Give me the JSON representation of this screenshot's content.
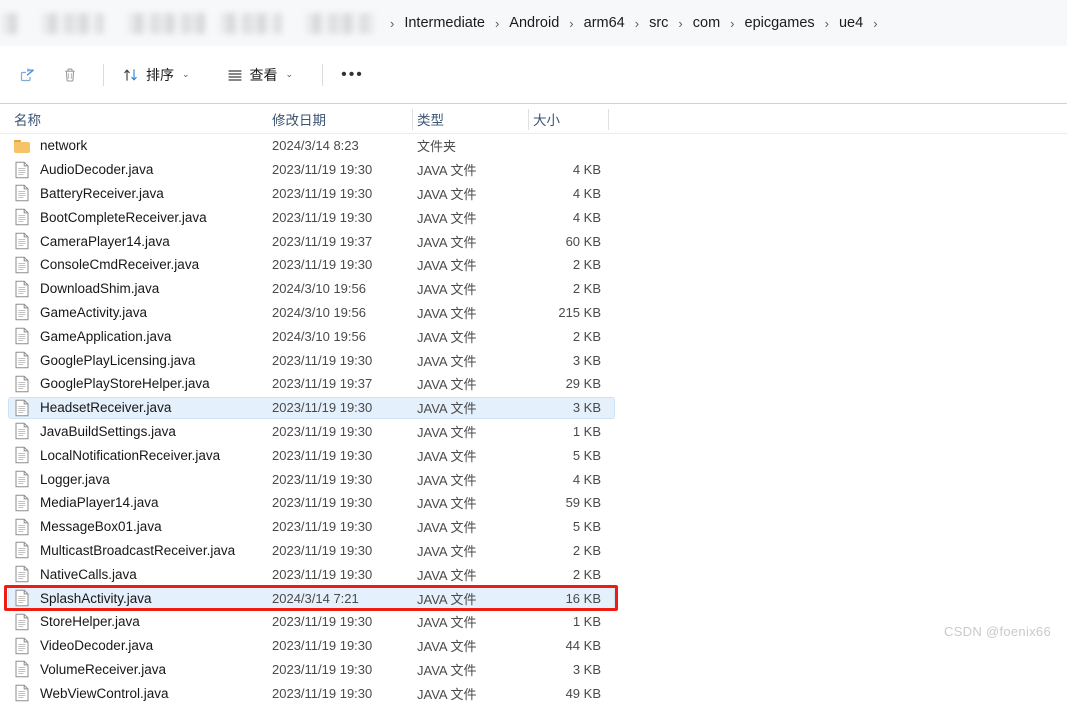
{
  "addressbar": {
    "redacted_segment_count": 5,
    "separator": "›",
    "crumbs": [
      "Intermediate",
      "Android",
      "arm64",
      "src",
      "com",
      "epicgames",
      "ue4"
    ]
  },
  "toolbar": {
    "share_label": "",
    "delete_label": "",
    "sort_label": "排序",
    "view_label": "查看",
    "more_label": "•••",
    "caret": "⌄",
    "icons": {
      "share": "share-icon",
      "delete": "trash-icon",
      "sort": "sort-arrows-icon",
      "view": "list-view-icon",
      "more": "ellipsis-icon"
    }
  },
  "columns": {
    "name": "名称",
    "date": "修改日期",
    "type": "类型",
    "size": "大小",
    "sort_indicator": "∧"
  },
  "colors": {
    "selection": "#e4f0fb",
    "selection_border": "#cfe3f6",
    "annotation_red": "#ef1c12",
    "folder_icon": "#f6c368",
    "header_text": "#3b5573",
    "addressbar_bg": "#f6f8fa"
  },
  "files": [
    {
      "name": "network",
      "date": "2024/3/14 8:23",
      "type": "文件夹",
      "size": "",
      "icon": "folder-icon",
      "selected": false,
      "annotated": false
    },
    {
      "name": "AudioDecoder.java",
      "date": "2023/11/19 19:30",
      "type": "JAVA 文件",
      "size": "4 KB",
      "icon": "file-icon",
      "selected": false,
      "annotated": false
    },
    {
      "name": "BatteryReceiver.java",
      "date": "2023/11/19 19:30",
      "type": "JAVA 文件",
      "size": "4 KB",
      "icon": "file-icon",
      "selected": false,
      "annotated": false
    },
    {
      "name": "BootCompleteReceiver.java",
      "date": "2023/11/19 19:30",
      "type": "JAVA 文件",
      "size": "4 KB",
      "icon": "file-icon",
      "selected": false,
      "annotated": false
    },
    {
      "name": "CameraPlayer14.java",
      "date": "2023/11/19 19:37",
      "type": "JAVA 文件",
      "size": "60 KB",
      "icon": "file-icon",
      "selected": false,
      "annotated": false
    },
    {
      "name": "ConsoleCmdReceiver.java",
      "date": "2023/11/19 19:30",
      "type": "JAVA 文件",
      "size": "2 KB",
      "icon": "file-icon",
      "selected": false,
      "annotated": false
    },
    {
      "name": "DownloadShim.java",
      "date": "2024/3/10 19:56",
      "type": "JAVA 文件",
      "size": "2 KB",
      "icon": "file-icon",
      "selected": false,
      "annotated": false
    },
    {
      "name": "GameActivity.java",
      "date": "2024/3/10 19:56",
      "type": "JAVA 文件",
      "size": "215 KB",
      "icon": "file-icon",
      "selected": false,
      "annotated": false
    },
    {
      "name": "GameApplication.java",
      "date": "2024/3/10 19:56",
      "type": "JAVA 文件",
      "size": "2 KB",
      "icon": "file-icon",
      "selected": false,
      "annotated": false
    },
    {
      "name": "GooglePlayLicensing.java",
      "date": "2023/11/19 19:30",
      "type": "JAVA 文件",
      "size": "3 KB",
      "icon": "file-icon",
      "selected": false,
      "annotated": false
    },
    {
      "name": "GooglePlayStoreHelper.java",
      "date": "2023/11/19 19:37",
      "type": "JAVA 文件",
      "size": "29 KB",
      "icon": "file-icon",
      "selected": false,
      "annotated": false
    },
    {
      "name": "HeadsetReceiver.java",
      "date": "2023/11/19 19:30",
      "type": "JAVA 文件",
      "size": "3 KB",
      "icon": "file-icon",
      "selected": true,
      "annotated": false
    },
    {
      "name": "JavaBuildSettings.java",
      "date": "2023/11/19 19:30",
      "type": "JAVA 文件",
      "size": "1 KB",
      "icon": "file-icon",
      "selected": false,
      "annotated": false
    },
    {
      "name": "LocalNotificationReceiver.java",
      "date": "2023/11/19 19:30",
      "type": "JAVA 文件",
      "size": "5 KB",
      "icon": "file-icon",
      "selected": false,
      "annotated": false
    },
    {
      "name": "Logger.java",
      "date": "2023/11/19 19:30",
      "type": "JAVA 文件",
      "size": "4 KB",
      "icon": "file-icon",
      "selected": false,
      "annotated": false
    },
    {
      "name": "MediaPlayer14.java",
      "date": "2023/11/19 19:30",
      "type": "JAVA 文件",
      "size": "59 KB",
      "icon": "file-icon",
      "selected": false,
      "annotated": false
    },
    {
      "name": "MessageBox01.java",
      "date": "2023/11/19 19:30",
      "type": "JAVA 文件",
      "size": "5 KB",
      "icon": "file-icon",
      "selected": false,
      "annotated": false
    },
    {
      "name": "MulticastBroadcastReceiver.java",
      "date": "2023/11/19 19:30",
      "type": "JAVA 文件",
      "size": "2 KB",
      "icon": "file-icon",
      "selected": false,
      "annotated": false
    },
    {
      "name": "NativeCalls.java",
      "date": "2023/11/19 19:30",
      "type": "JAVA 文件",
      "size": "2 KB",
      "icon": "file-icon",
      "selected": false,
      "annotated": false
    },
    {
      "name": "SplashActivity.java",
      "date": "2024/3/14 7:21",
      "type": "JAVA 文件",
      "size": "16 KB",
      "icon": "file-icon",
      "selected": true,
      "annotated": true
    },
    {
      "name": "StoreHelper.java",
      "date": "2023/11/19 19:30",
      "type": "JAVA 文件",
      "size": "1 KB",
      "icon": "file-icon",
      "selected": false,
      "annotated": false
    },
    {
      "name": "VideoDecoder.java",
      "date": "2023/11/19 19:30",
      "type": "JAVA 文件",
      "size": "44 KB",
      "icon": "file-icon",
      "selected": false,
      "annotated": false
    },
    {
      "name": "VolumeReceiver.java",
      "date": "2023/11/19 19:30",
      "type": "JAVA 文件",
      "size": "3 KB",
      "icon": "file-icon",
      "selected": false,
      "annotated": false
    },
    {
      "name": "WebViewControl.java",
      "date": "2023/11/19 19:30",
      "type": "JAVA 文件",
      "size": "49 KB",
      "icon": "file-icon",
      "selected": false,
      "annotated": false
    }
  ],
  "watermark": "CSDN @foenix66"
}
